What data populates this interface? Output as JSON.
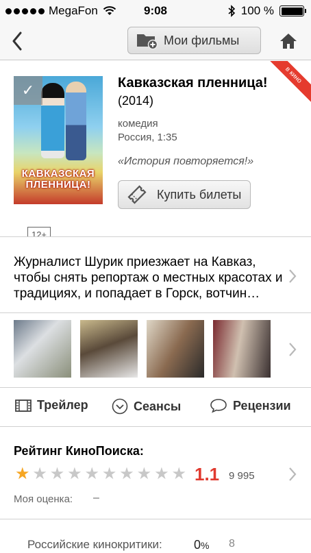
{
  "status_bar": {
    "carrier": "MegaFon",
    "time": "9:08",
    "battery": "100 %"
  },
  "nav": {
    "my_films_label": "Мои фильмы"
  },
  "movie": {
    "title": "Кавказская пленница!",
    "year": "(2014)",
    "genre": "комедия",
    "country_duration": "Россия, 1:35",
    "tagline": "«История повторяется!»",
    "age_rating": "12+",
    "ribbon": "в кино",
    "poster_title": "КАВКАЗСКАЯ ПЛЕННИЦА!",
    "buy_tickets_label": "Купить билеты"
  },
  "description": "Журналист Шурик приезжает на Кавказ, чтобы снять репортаж о местных красотах и традициях, и попадает в Горск, вотчин…",
  "actions": {
    "trailer": "Трейлер",
    "sessions": "Сеансы",
    "reviews": "Рецензии"
  },
  "rating": {
    "heading": "Рейтинг КиноПоиска:",
    "score": "1.1",
    "votes": "9 995",
    "stars_filled": 1,
    "stars_total": 10,
    "my_rating_label": "Моя оценка:",
    "my_rating_value": "–"
  },
  "critics": {
    "label": "Российские кинокритики:",
    "percent": "0",
    "percent_sign": "%",
    "count": "8"
  },
  "colors": {
    "accent_red": "#e03a2f",
    "star_gold": "#f6a623",
    "ribbon_red": "#e53b2e"
  }
}
